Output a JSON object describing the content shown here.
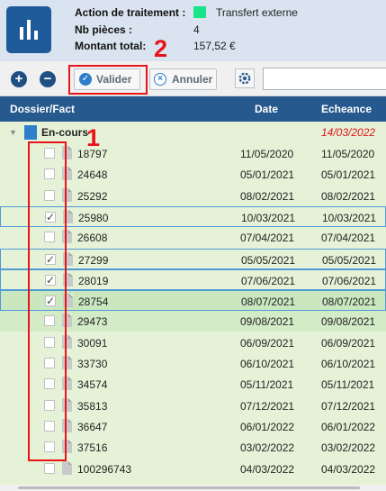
{
  "header": {
    "action_label": "Action de traitement :",
    "action_value": "Transfert externe",
    "action_color": "#18e58a",
    "pieces_label": "Nb pièces :",
    "pieces_value": "4",
    "total_label": "Montant total:",
    "total_value": "157,52 €"
  },
  "toolbar": {
    "add_icon": "plus-circle-icon",
    "remove_icon": "minus-circle-icon",
    "validate_label": "Valider",
    "cancel_label": "Annuler",
    "settings_icon": "gear-icon",
    "search_value": ""
  },
  "annotations": {
    "one": "1",
    "two": "2",
    "color": "#e8141a"
  },
  "table": {
    "columns": [
      "Dossier/Fact",
      "Date",
      "Echeance"
    ],
    "group": {
      "label": "En-cours",
      "date": "14/03/2022"
    },
    "rows": [
      {
        "id": "18797",
        "date": "11/05/2020",
        "echeance": "11/05/2020",
        "checked": false
      },
      {
        "id": "24648",
        "date": "05/01/2021",
        "echeance": "05/01/2021",
        "checked": false
      },
      {
        "id": "25292",
        "date": "08/02/2021",
        "echeance": "08/02/2021",
        "checked": false
      },
      {
        "id": "25980",
        "date": "10/03/2021",
        "echeance": "10/03/2021",
        "checked": true
      },
      {
        "id": "26608",
        "date": "07/04/2021",
        "echeance": "07/04/2021",
        "checked": false
      },
      {
        "id": "27299",
        "date": "05/05/2021",
        "echeance": "05/05/2021",
        "checked": true
      },
      {
        "id": "28019",
        "date": "07/06/2021",
        "echeance": "07/06/2021",
        "checked": true
      },
      {
        "id": "28754",
        "date": "08/07/2021",
        "echeance": "08/07/2021",
        "checked": true
      },
      {
        "id": "29473",
        "date": "09/08/2021",
        "echeance": "09/08/2021",
        "checked": false
      },
      {
        "id": "30091",
        "date": "06/09/2021",
        "echeance": "06/09/2021",
        "checked": false
      },
      {
        "id": "33730",
        "date": "06/10/2021",
        "echeance": "06/10/2021",
        "checked": false
      },
      {
        "id": "34574",
        "date": "05/11/2021",
        "echeance": "05/11/2021",
        "checked": false
      },
      {
        "id": "35813",
        "date": "07/12/2021",
        "echeance": "07/12/2021",
        "checked": false
      },
      {
        "id": "36647",
        "date": "06/01/2022",
        "echeance": "06/01/2022",
        "checked": false
      },
      {
        "id": "37516",
        "date": "03/02/2022",
        "echeance": "03/02/2022",
        "checked": false
      },
      {
        "id": "100296743",
        "date": "04/03/2022",
        "echeance": "04/03/2022",
        "checked": false
      }
    ]
  }
}
